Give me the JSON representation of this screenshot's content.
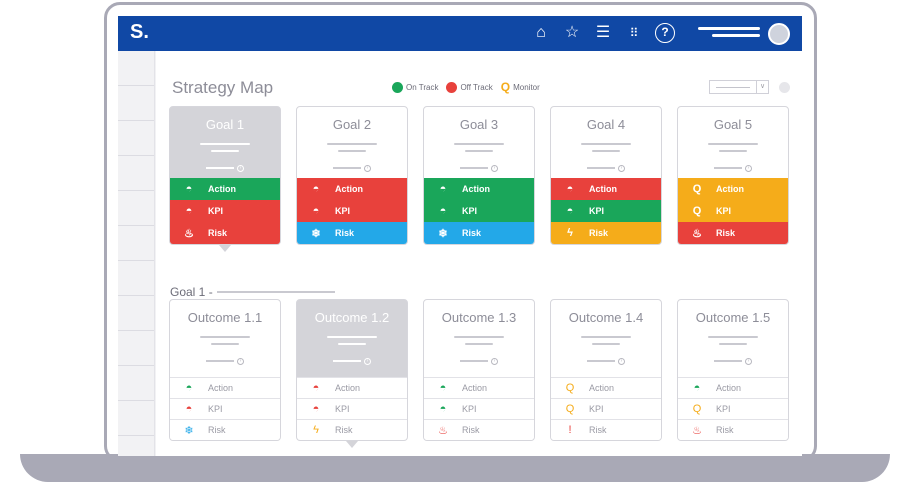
{
  "app": {
    "logo": "S."
  },
  "header": {
    "title": "Strategy Map"
  },
  "legend": [
    {
      "label": "On Track",
      "color": "#1aa65a",
      "icon": "on-track-icon"
    },
    {
      "label": "Off Track",
      "color": "#e8413c",
      "icon": "off-track-icon"
    },
    {
      "label": "Monitor",
      "color": "#f5ac1a",
      "icon": "monitor-icon"
    }
  ],
  "colors": {
    "green": "#1aa65a",
    "red": "#e8413c",
    "orange": "#f5ac1a",
    "blue": "#23a8e8",
    "topbar": "#1048a5"
  },
  "goals": [
    {
      "title": "Goal 1",
      "selected": true,
      "rows": [
        {
          "label": "Action",
          "status": "green",
          "icon": "gauge-icon"
        },
        {
          "label": "KPI",
          "status": "red",
          "icon": "gauge-icon"
        },
        {
          "label": "Risk",
          "status": "red",
          "icon": "fire-icon"
        }
      ]
    },
    {
      "title": "Goal 2",
      "selected": false,
      "rows": [
        {
          "label": "Action",
          "status": "red",
          "icon": "gauge-icon"
        },
        {
          "label": "KPI",
          "status": "red",
          "icon": "gauge-icon"
        },
        {
          "label": "Risk",
          "status": "blue",
          "icon": "snowflake-icon"
        }
      ]
    },
    {
      "title": "Goal 3",
      "selected": false,
      "rows": [
        {
          "label": "Action",
          "status": "green",
          "icon": "gauge-icon"
        },
        {
          "label": "KPI",
          "status": "green",
          "icon": "gauge-icon"
        },
        {
          "label": "Risk",
          "status": "blue",
          "icon": "snowflake-icon"
        }
      ]
    },
    {
      "title": "Goal 4",
      "selected": false,
      "rows": [
        {
          "label": "Action",
          "status": "red",
          "icon": "gauge-icon"
        },
        {
          "label": "KPI",
          "status": "green",
          "icon": "gauge-icon"
        },
        {
          "label": "Risk",
          "status": "orange",
          "icon": "lightning-icon"
        }
      ]
    },
    {
      "title": "Goal 5",
      "selected": false,
      "rows": [
        {
          "label": "Action",
          "status": "orange",
          "icon": "magnifier-icon"
        },
        {
          "label": "KPI",
          "status": "orange",
          "icon": "magnifier-icon"
        },
        {
          "label": "Risk",
          "status": "red",
          "icon": "fire-icon"
        }
      ]
    }
  ],
  "section": {
    "label": "Goal 1 -"
  },
  "outcomes": [
    {
      "title": "Outcome 1.1",
      "selected": false,
      "rows": [
        {
          "label": "Action",
          "status": "green",
          "icon": "gauge-icon"
        },
        {
          "label": "KPI",
          "status": "red",
          "icon": "gauge-icon"
        },
        {
          "label": "Risk",
          "status": "blue",
          "icon": "snowflake-icon"
        }
      ]
    },
    {
      "title": "Outcome 1.2",
      "selected": true,
      "rows": [
        {
          "label": "Action",
          "status": "red",
          "icon": "gauge-icon"
        },
        {
          "label": "KPI",
          "status": "red",
          "icon": "gauge-icon"
        },
        {
          "label": "Risk",
          "status": "orange",
          "icon": "lightning-icon"
        }
      ]
    },
    {
      "title": "Outcome 1.3",
      "selected": false,
      "rows": [
        {
          "label": "Action",
          "status": "green",
          "icon": "gauge-icon"
        },
        {
          "label": "KPI",
          "status": "green",
          "icon": "gauge-icon"
        },
        {
          "label": "Risk",
          "status": "red",
          "icon": "fire-icon"
        }
      ]
    },
    {
      "title": "Outcome 1.4",
      "selected": false,
      "rows": [
        {
          "label": "Action",
          "status": "orange",
          "icon": "magnifier-icon"
        },
        {
          "label": "KPI",
          "status": "orange",
          "icon": "magnifier-icon"
        },
        {
          "label": "Risk",
          "status": "red",
          "icon": "exclamation-icon"
        }
      ]
    },
    {
      "title": "Outcome 1.5",
      "selected": false,
      "rows": [
        {
          "label": "Action",
          "status": "green",
          "icon": "gauge-icon"
        },
        {
          "label": "KPI",
          "status": "orange",
          "icon": "magnifier-icon"
        },
        {
          "label": "Risk",
          "status": "red",
          "icon": "fire-icon"
        }
      ]
    }
  ]
}
